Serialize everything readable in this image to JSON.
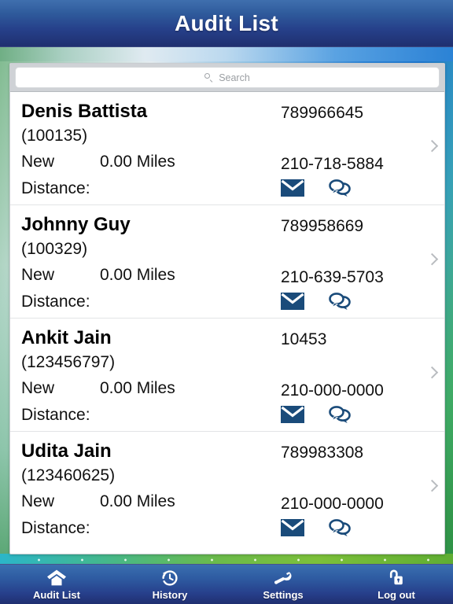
{
  "header": {
    "title": "Audit List"
  },
  "search": {
    "placeholder": "Search",
    "value": "",
    "icon": "search-icon"
  },
  "colors": {
    "header_start": "#3f6fae",
    "header_end": "#1f2f6e",
    "action_icon": "#1a4b7a",
    "chevron": "#b9bcc0",
    "card_bg": "#ffffff",
    "searchbar_bg": "#cfd2d6"
  },
  "list": {
    "rows": [
      {
        "name": "Denis Battista",
        "customer_id": "(100135)",
        "status": "New",
        "miles": "0.00 Miles",
        "distance_label": "Distance:",
        "account_number": "789966645",
        "phone": "210-718-5884",
        "email_icon": "envelope-icon",
        "chat_icon": "chat-bubbles-icon",
        "chevron_icon": "chevron-right-icon"
      },
      {
        "name": "Johnny Guy",
        "customer_id": "(100329)",
        "status": "New",
        "miles": "0.00 Miles",
        "distance_label": "Distance:",
        "account_number": "789958669",
        "phone": "210-639-5703",
        "email_icon": "envelope-icon",
        "chat_icon": "chat-bubbles-icon",
        "chevron_icon": "chevron-right-icon"
      },
      {
        "name": "Ankit Jain",
        "customer_id": "(123456797)",
        "status": "New",
        "miles": "0.00 Miles",
        "distance_label": "Distance:",
        "account_number": "10453",
        "phone": "210-000-0000",
        "email_icon": "envelope-icon",
        "chat_icon": "chat-bubbles-icon",
        "chevron_icon": "chevron-right-icon"
      },
      {
        "name": "Udita Jain",
        "customer_id": "(123460625)",
        "status": "New",
        "miles": "0.00 Miles",
        "distance_label": "Distance:",
        "account_number": "789983308",
        "phone": "210-000-0000",
        "email_icon": "envelope-icon",
        "chat_icon": "chat-bubbles-icon",
        "chevron_icon": "chevron-right-icon"
      }
    ]
  },
  "tabbar": {
    "items": [
      {
        "label": "Audit List",
        "icon": "home-icon",
        "active": true
      },
      {
        "label": "History",
        "icon": "clock-history-icon",
        "active": false
      },
      {
        "label": "Settings",
        "icon": "wrench-icon",
        "active": false
      },
      {
        "label": "Log out",
        "icon": "unlocked-padlock-icon",
        "active": false
      }
    ]
  }
}
